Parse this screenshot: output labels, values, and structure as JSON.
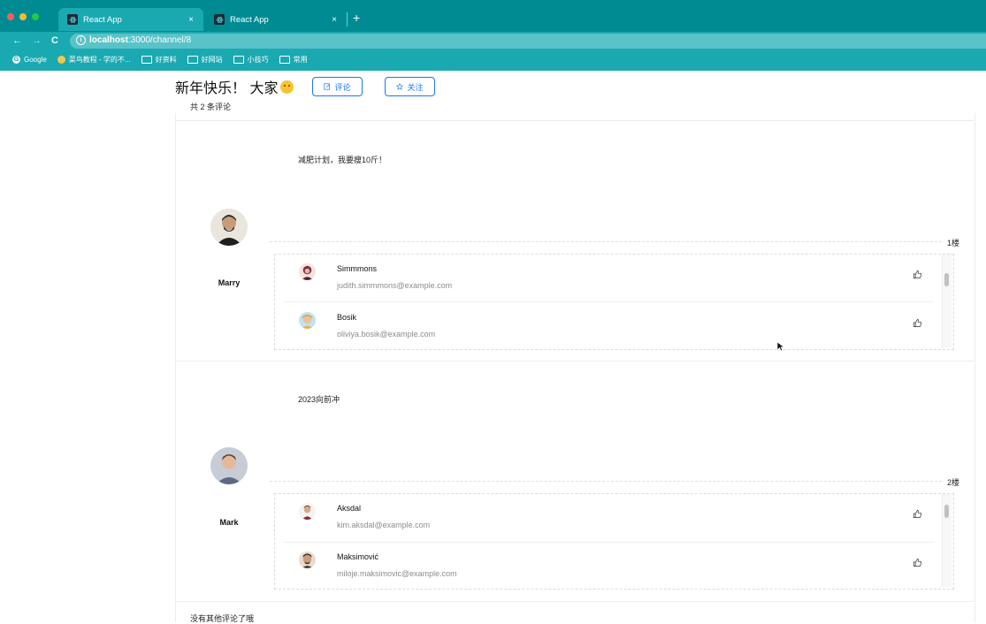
{
  "browser": {
    "tabs": [
      {
        "title": "React App",
        "close": "×"
      },
      {
        "title": "React App",
        "close": "×"
      }
    ],
    "new_tab": "+",
    "url_host": "localhost",
    "url_path": ":3000/channel/8",
    "bookmarks": [
      "Google",
      "菜鸟教程 - 学的不...",
      "好资料",
      "好网站",
      "小技巧",
      "常用"
    ],
    "colors": {
      "tabbar": "#008b93",
      "toolbar": "#1aa9b1"
    }
  },
  "header": {
    "title": "新年快乐！ 大家",
    "comment_button": "评论",
    "follow_button": "关注",
    "accent": "#1677ff"
  },
  "comment_count": "共 2 条评论",
  "comments": [
    {
      "text": "减肥计划，我要瘦10斤！",
      "user": "Marry",
      "floor": "1楼",
      "replies": [
        {
          "name": "Simmmons",
          "email": "judith.simmmons@example.com"
        },
        {
          "name": "Bosik",
          "email": "oliviya.bosik@example.com"
        }
      ]
    },
    {
      "text": "2023向前冲",
      "user": "Mark",
      "floor": "2楼",
      "replies": [
        {
          "name": "Aksdal",
          "email": "kim.aksdal@example.com"
        },
        {
          "name": "Maksimović",
          "email": "miloje.maksimovic@example.com"
        }
      ]
    }
  ],
  "no_more": "没有其他评论了哦"
}
